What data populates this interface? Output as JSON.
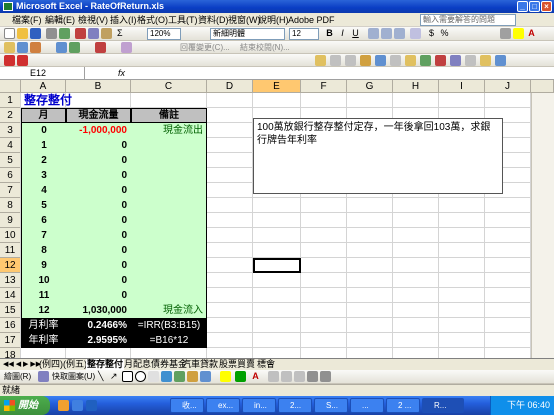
{
  "window": {
    "title": "Microsoft Excel - RateOfReturn.xls",
    "controls": [
      "_",
      "□",
      "×"
    ]
  },
  "menu": {
    "items": [
      "檔案(F)",
      "編輯(E)",
      "檢視(V)",
      "插入(I)",
      "格式(O)",
      "工具(T)",
      "資料(D)",
      "視窗(W)",
      "說明(H)",
      "Adobe PDF"
    ],
    "ask_placeholder": "輸入需要解答的問題"
  },
  "toolbar": {
    "zoom": "120%",
    "font_name": "新細明體",
    "font_size": "12",
    "bold": "B",
    "italic": "I",
    "underline": "U",
    "reply_changes": "回覆變更(C)...",
    "end_review": "結束校閱(N)..."
  },
  "formula_bar": {
    "name_box": "E12",
    "fx": "fx",
    "content": ""
  },
  "sheet": {
    "columns": [
      "A",
      "B",
      "C",
      "D",
      "E",
      "F",
      "G",
      "H",
      "I",
      "J"
    ],
    "rows": [
      "1",
      "2",
      "3",
      "4",
      "5",
      "6",
      "7",
      "8",
      "9",
      "10",
      "11",
      "12",
      "13",
      "14",
      "15",
      "16",
      "17",
      "18"
    ],
    "selected_cell": "E12",
    "title": "整存整付",
    "headers": {
      "month": "月",
      "cashflow": "現金流量",
      "note": "備註"
    },
    "data_rows": [
      {
        "month": "0",
        "cashflow": "-1,000,000",
        "note": "現金流出"
      },
      {
        "month": "1",
        "cashflow": "0",
        "note": ""
      },
      {
        "month": "2",
        "cashflow": "0",
        "note": ""
      },
      {
        "month": "3",
        "cashflow": "0",
        "note": ""
      },
      {
        "month": "4",
        "cashflow": "0",
        "note": ""
      },
      {
        "month": "5",
        "cashflow": "0",
        "note": ""
      },
      {
        "month": "6",
        "cashflow": "0",
        "note": ""
      },
      {
        "month": "7",
        "cashflow": "0",
        "note": ""
      },
      {
        "month": "8",
        "cashflow": "0",
        "note": ""
      },
      {
        "month": "9",
        "cashflow": "0",
        "note": ""
      },
      {
        "month": "10",
        "cashflow": "0",
        "note": ""
      },
      {
        "month": "11",
        "cashflow": "0",
        "note": ""
      },
      {
        "month": "12",
        "cashflow": "1,030,000",
        "note": "現金流入"
      }
    ],
    "monthly_rate": {
      "label": "月利率",
      "value": "0.2466%",
      "formula": "=IRR(B3:B15)"
    },
    "annual_rate": {
      "label": "年利率",
      "value": "2.9595%",
      "formula": "=B16*12"
    },
    "textbox": "100萬放銀行整存整付定存，一年後拿回103萬，求銀行牌告年利率",
    "colors": {
      "negative": "#ff0000",
      "green_fill": "#ccffcc",
      "title_blue": "#0000cc"
    }
  },
  "sheet_tabs": [
    "(例四)",
    "(例五)",
    "整存整付",
    "月配息債券基金",
    "汽車貸款",
    "股票買賣",
    "標會"
  ],
  "active_tab": "整存整付",
  "draw_toolbar": {
    "draw": "繪圖(R)",
    "autoshapes": "快取圖案(U)"
  },
  "status": "就緒",
  "taskbar": {
    "start": "開始",
    "buttons": [
      "收...",
      "ex...",
      "in...",
      "2...",
      "S...",
      "...",
      "2 ...",
      "R..."
    ],
    "clock": "下午 06:40"
  }
}
